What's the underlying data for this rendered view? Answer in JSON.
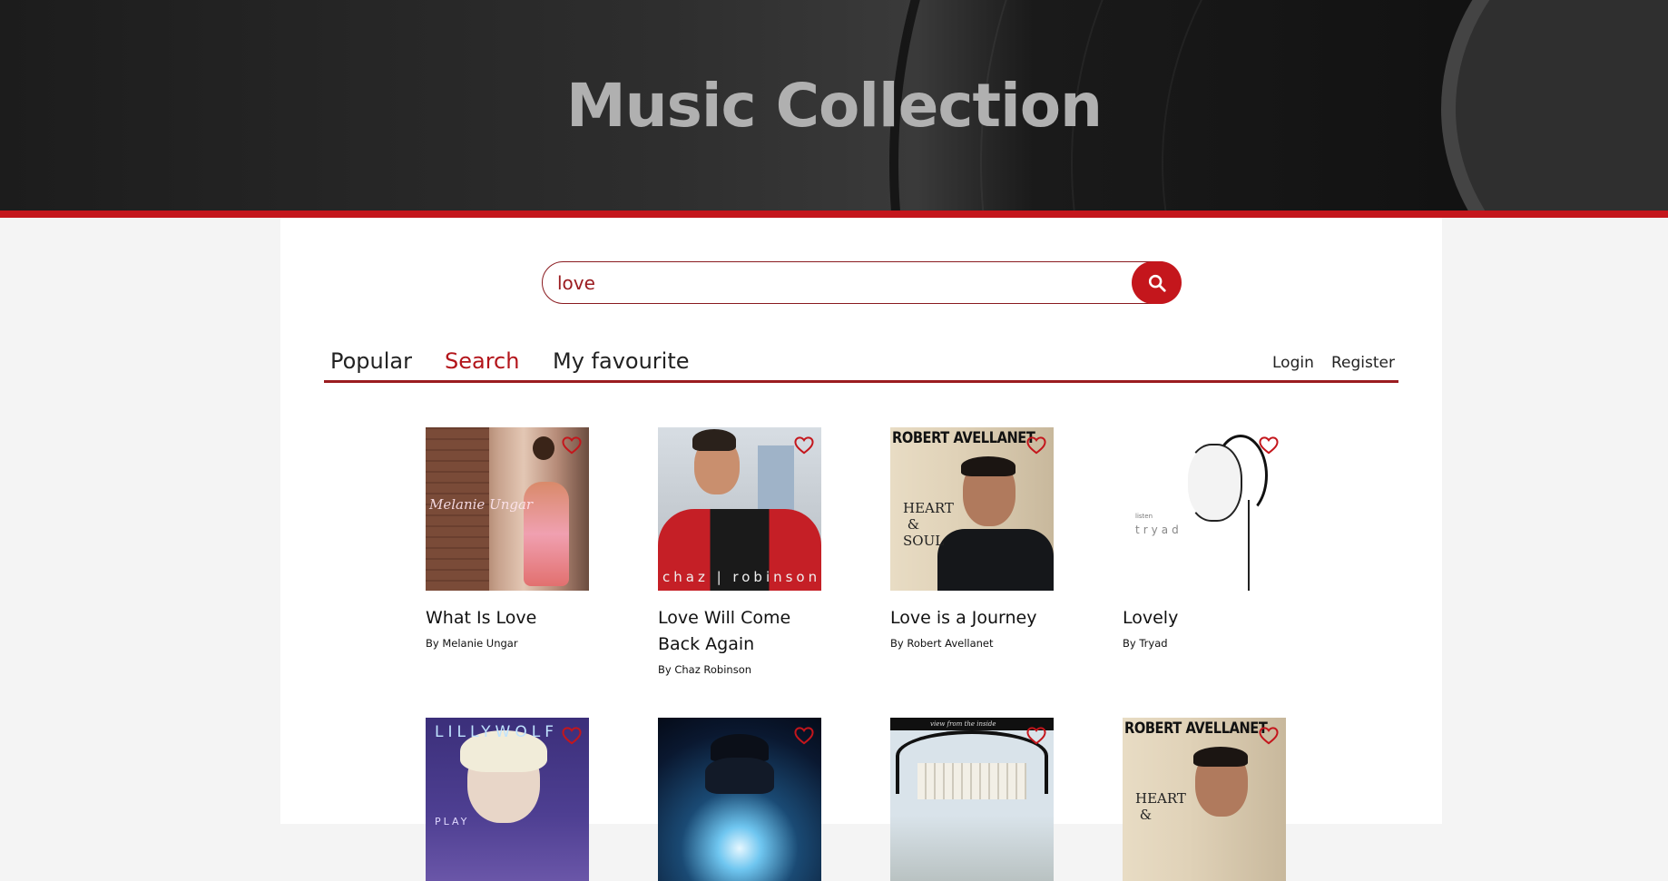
{
  "header": {
    "title": "Music Collection"
  },
  "search": {
    "value": "love",
    "placeholder": ""
  },
  "nav": {
    "tabs": [
      {
        "label": "Popular",
        "active": false
      },
      {
        "label": "Search",
        "active": true
      },
      {
        "label": "My favourite",
        "active": false
      }
    ],
    "login_label": "Login",
    "register_label": "Register"
  },
  "results": [
    {
      "title": "What Is Love",
      "artist": "By Melanie Ungar",
      "cover_text": "Melanie Ungar"
    },
    {
      "title": "Love Will Come Back Again",
      "artist": "By Chaz Robinson",
      "cover_text": "chaz | robinson"
    },
    {
      "title": "Love is a Journey",
      "artist": "By Robert Avellanet",
      "cover_text": "ROBERT AVELLANET"
    },
    {
      "title": "Lovely",
      "artist": "By Tryad",
      "cover_text": "tryad"
    },
    {
      "title": "",
      "artist": "",
      "cover_text": "LILLYWOLF"
    },
    {
      "title": "",
      "artist": "",
      "cover_text": ""
    },
    {
      "title": "",
      "artist": "",
      "cover_text": ""
    },
    {
      "title": "",
      "artist": "",
      "cover_text": "ROBERT AVELLANET"
    }
  ],
  "colors": {
    "accent": "#c4161c",
    "accent_dark": "#9b1c20",
    "background": "#f4f4f4",
    "panel": "#ffffff"
  }
}
